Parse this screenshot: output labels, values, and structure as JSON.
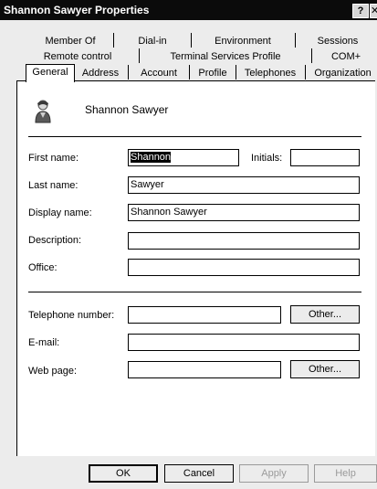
{
  "window": {
    "title": "Shannon Sawyer Properties",
    "help_glyph": "?",
    "close_glyph": "✕"
  },
  "tabs": {
    "row1": [
      "Member Of",
      "Dial-in",
      "Environment",
      "Sessions"
    ],
    "row2": [
      "Remote control",
      "Terminal Services Profile",
      "COM+"
    ],
    "row3": [
      "General",
      "Address",
      "Account",
      "Profile",
      "Telephones",
      "Organization"
    ],
    "active": "General"
  },
  "general": {
    "display_header": "Shannon Sawyer",
    "first_name_label": "First name:",
    "first_name_value": "Shannon",
    "initials_label": "Initials:",
    "initials_value": "",
    "last_name_label": "Last name:",
    "last_name_value": "Sawyer",
    "display_name_label": "Display name:",
    "display_name_value": "Shannon Sawyer",
    "description_label": "Description:",
    "description_value": "",
    "office_label": "Office:",
    "office_value": "",
    "telephone_label": "Telephone number:",
    "telephone_value": "",
    "email_label": "E-mail:",
    "email_value": "",
    "webpage_label": "Web page:",
    "webpage_value": "",
    "other_label": "Other..."
  },
  "footer": {
    "ok": "OK",
    "cancel": "Cancel",
    "apply": "Apply",
    "help": "Help"
  },
  "colors": {
    "titlebar": "#0b0b0b",
    "selection": "#000000",
    "disabled_text": "#9a9a9a"
  }
}
